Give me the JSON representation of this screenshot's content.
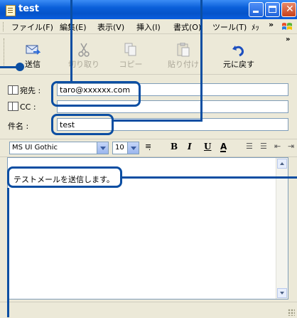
{
  "window": {
    "title": "test"
  },
  "menu": {
    "items": [
      "ファイル(F)",
      "編集(E)",
      "表示(V)",
      "挿入(I)",
      "書式(O)",
      "ツール(T)",
      "ﾒｯ"
    ]
  },
  "toolbar": {
    "send": "送信",
    "cut": "切り取り",
    "copy": "コピー",
    "paste": "貼り付け",
    "undo": "元に戻す"
  },
  "header": {
    "to_label": "宛先 :",
    "to_value": "taro@xxxxxx.com",
    "cc_label": "CC :",
    "cc_value": "",
    "subject_label": "件名 :",
    "subject_value": "test"
  },
  "format": {
    "font": "MS UI Gothic",
    "size": "10"
  },
  "body": {
    "text": "テストメールを送信します。"
  },
  "colors": {
    "accent": "#0b4ea2",
    "titlebar": "#0553c9"
  }
}
